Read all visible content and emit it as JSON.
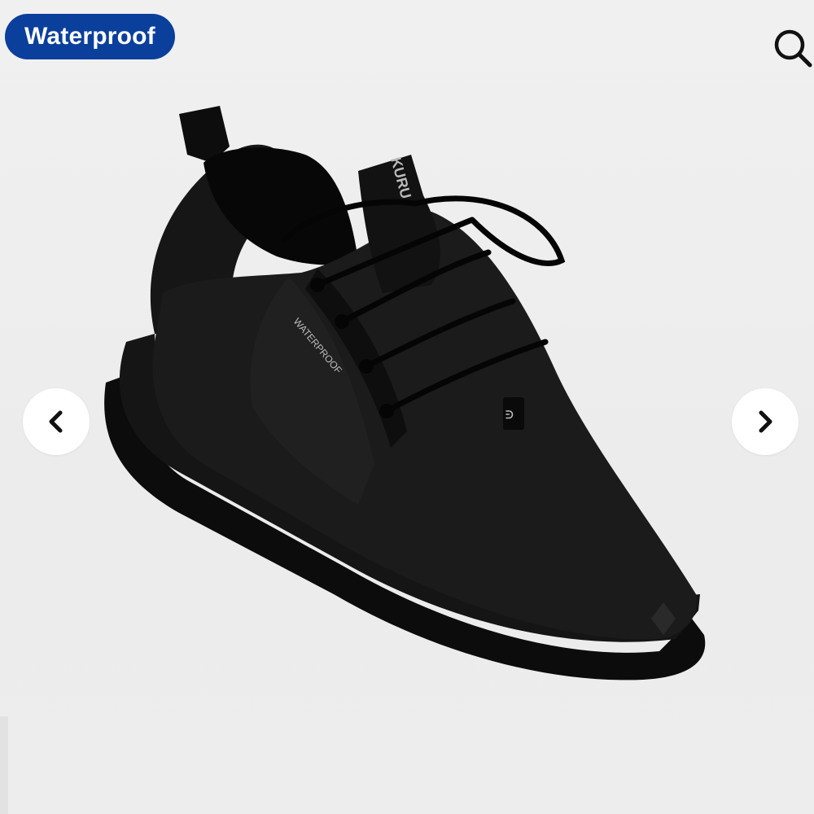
{
  "badge": {
    "label": "Waterproof",
    "color": "#0a3f9c"
  },
  "icons": {
    "search": "search-icon",
    "prev": "chevron-left-icon",
    "next": "chevron-right-icon"
  },
  "product_image": {
    "alt": "Black knit waterproof sneaker",
    "printed_texts": [
      "KURU",
      "WATERPROOF"
    ]
  },
  "colors": {
    "background": "#efefef",
    "shoe": "#111111",
    "button_bg": "#ffffff"
  }
}
